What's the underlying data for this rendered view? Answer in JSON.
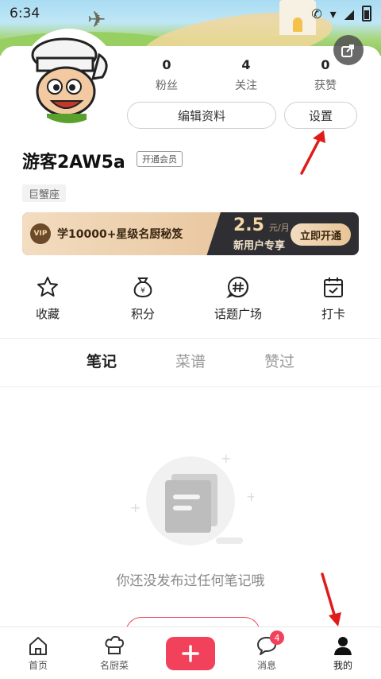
{
  "status_bar": {
    "time": "6:34"
  },
  "profile": {
    "username": "游客2AW5a",
    "member_badge": "开通会员",
    "zodiac": "巨蟹座",
    "stats": [
      {
        "count": "0",
        "label": "粉丝"
      },
      {
        "count": "4",
        "label": "关注"
      },
      {
        "count": "0",
        "label": "获赞"
      }
    ],
    "edit_button": "编辑资料",
    "settings_button": "设置"
  },
  "vip_banner": {
    "tag": "VIP",
    "text": "学10000+星级名厨秘笈",
    "price": "2.5",
    "unit": "元/月",
    "subtitle": "新用户专享",
    "button": "立即开通"
  },
  "quick_actions": [
    {
      "label": "收藏",
      "icon": "star-icon"
    },
    {
      "label": "积分",
      "icon": "points-bag-icon"
    },
    {
      "label": "话题广场",
      "icon": "topic-hash-icon"
    },
    {
      "label": "打卡",
      "icon": "calendar-check-icon"
    }
  ],
  "tabs": [
    {
      "label": "笔记",
      "active": true
    },
    {
      "label": "菜谱",
      "active": false
    },
    {
      "label": "赞过",
      "active": false
    }
  ],
  "empty_state": {
    "text": "你还没发布过任何笔记哦"
  },
  "bottom_nav": [
    {
      "label": "首页",
      "icon": "home-icon"
    },
    {
      "label": "名厨菜",
      "icon": "chef-hat-icon"
    },
    {
      "label": "",
      "icon": "plus-icon"
    },
    {
      "label": "消息",
      "icon": "message-icon",
      "badge": "4"
    },
    {
      "label": "我的",
      "icon": "person-icon",
      "active": true
    }
  ],
  "colors": {
    "accent": "#f2415a",
    "vip_gold": "#e9c8a1",
    "vip_dark": "#2f2f33"
  }
}
